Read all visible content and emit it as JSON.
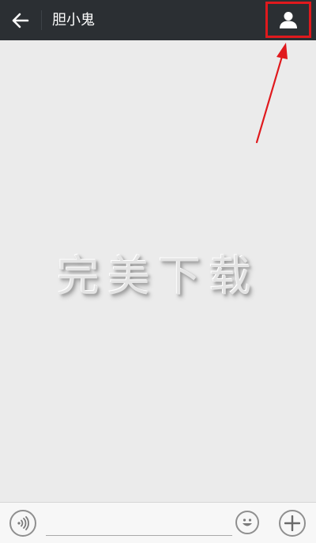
{
  "header": {
    "title": "胆小鬼",
    "back_icon": "arrow-left-icon",
    "profile_icon": "person-icon",
    "highlight_color": "#e0191d",
    "bar_color": "#2b2f33"
  },
  "watermark": {
    "text": "完美下载"
  },
  "input_bar": {
    "voice_icon": "voice-icon",
    "message_input_value": "",
    "emoji_icon": "emoji-icon",
    "more_icon": "plus-icon"
  }
}
